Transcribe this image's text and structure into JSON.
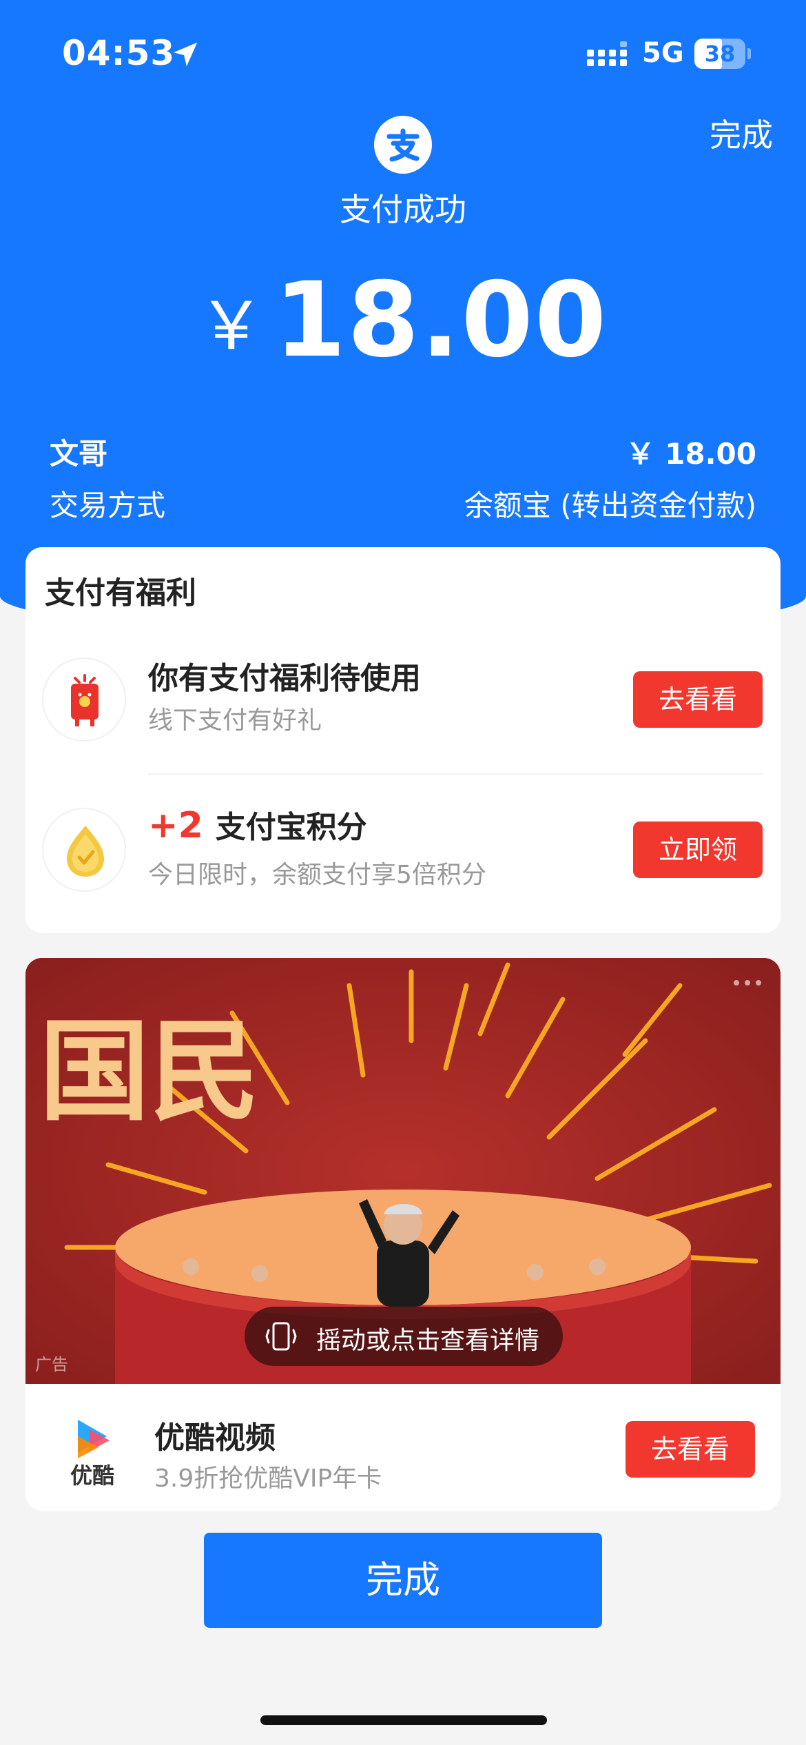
{
  "status_bar": {
    "time": "04:53",
    "network": "5G",
    "battery": "38"
  },
  "header": {
    "done_label": "完成",
    "title": "支付成功",
    "currency": "￥",
    "amount": "18.00"
  },
  "details": {
    "payee_name": "文哥",
    "payee_amount": "￥ 18.00",
    "method_label": "交易方式",
    "method_value": "余额宝 (转出资金付款)"
  },
  "benefits": {
    "title": "支付有福利",
    "items": [
      {
        "title": "你有支付福利待使用",
        "subtitle": "线下支付有好礼",
        "button": "去看看",
        "icon": "red-envelope-icon"
      },
      {
        "points": "+2",
        "title": "支付宝积分",
        "subtitle": "今日限时，余额支付享5倍积分",
        "button": "立即领",
        "icon": "points-coin-icon"
      }
    ]
  },
  "ad": {
    "banner_text": "国民",
    "hint": "摇动或点击查看详情",
    "tag": "广告",
    "app_logo_text": "优酷",
    "app_name": "优酷视频",
    "app_subtitle": "3.9折抢优酷VIP年卡",
    "button": "去看看"
  },
  "footer": {
    "done_button": "完成"
  },
  "colors": {
    "primary_blue": "#1677ff",
    "accent_red": "#f2372e",
    "background": "#f4f4f4"
  }
}
